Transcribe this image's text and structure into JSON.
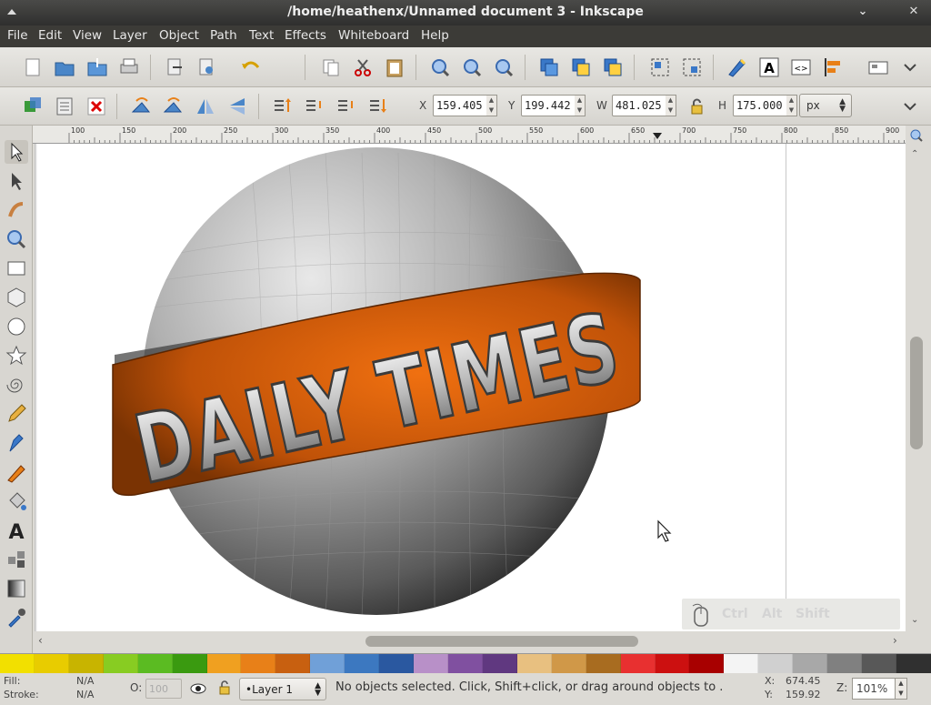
{
  "window": {
    "title": "/home/heathenx/Unnamed document 3 - Inkscape",
    "controls": [
      "chevron-down-icon",
      "close-icon"
    ]
  },
  "menu": [
    "File",
    "Edit",
    "View",
    "Layer",
    "Object",
    "Path",
    "Text",
    "Effects",
    "Whiteboard",
    "Help"
  ],
  "command_bar": {
    "icons": [
      "new-document-icon",
      "open-icon",
      "import-icon",
      "print-icon",
      "export-icon",
      "export-bitmap-icon",
      "undo-icon",
      "copy-icon",
      "cut-icon",
      "paste-icon",
      "zoom-selection-icon",
      "zoom-drawing-icon",
      "zoom-page-icon",
      "duplicate-icon",
      "clone-icon",
      "unlink-clone-icon",
      "group-icon",
      "ungroup-icon",
      "fill-stroke-icon",
      "text-font-icon",
      "xml-editor-icon",
      "align-icon",
      "preferences-icon",
      "more-icon"
    ]
  },
  "control_bar": {
    "icons": [
      "select-all-icon",
      "select-all-layers-icon",
      "deselect-icon",
      "rotate-ccw-icon",
      "rotate-cw-icon",
      "flip-horizontal-icon",
      "flip-vertical-icon",
      "raise-top-icon",
      "raise-icon",
      "lower-icon",
      "lower-bottom-icon"
    ],
    "x_label": "X",
    "x_value": "159.405",
    "y_label": "Y",
    "y_value": "199.442",
    "w_label": "W",
    "w_value": "481.025",
    "h_label": "H",
    "h_value": "175.000",
    "unit": "px"
  },
  "rulers": {
    "marks": [
      "100",
      "150",
      "200",
      "250",
      "300",
      "350",
      "400",
      "450",
      "500",
      "550",
      "600",
      "650",
      "700",
      "750",
      "800",
      "850",
      "900",
      "950"
    ]
  },
  "toolbox": [
    "selector-icon",
    "node-icon",
    "tweak-icon",
    "zoom-icon",
    "rectangle-icon",
    "box3d-icon",
    "ellipse-icon",
    "star-icon",
    "spiral-icon",
    "pencil-icon",
    "pen-icon",
    "calligraphy-icon",
    "paint-bucket-icon",
    "text-icon",
    "spray-icon",
    "gradient-icon",
    "dropper-icon"
  ],
  "artwork": {
    "banner_text": "DAILY TIMES",
    "sphere_colors": {
      "light": "#e8e8e8",
      "dark": "#2b2b2b"
    },
    "banner_colors": {
      "bright": "#f07010",
      "dark": "#7a3303"
    }
  },
  "keys_overlay": {
    "ctrl": "Ctrl",
    "alt": "Alt",
    "shift": "Shift"
  },
  "palette": [
    "#f2e000",
    "#e8cc00",
    "#c8b400",
    "#88cc22",
    "#5bbb22",
    "#3a9a10",
    "#f0a020",
    "#e88018",
    "#c86010",
    "#70a0d8",
    "#3c78c0",
    "#2a58a0",
    "#b890c8",
    "#8050a0",
    "#603880",
    "#e8c080",
    "#d09848",
    "#a86c20",
    "#e83030",
    "#cc1010",
    "#a80000",
    "#f4f4f4",
    "#d0d0d0",
    "#a8a8a8",
    "#808080",
    "#585858",
    "#303030"
  ],
  "status": {
    "fill_label": "Fill:",
    "fill_value": "N/A",
    "stroke_label": "Stroke:",
    "stroke_value": "N/A",
    "opacity_label": "O:",
    "opacity_value": "100",
    "layer": "•Layer 1",
    "message": "No objects selected. Click, Shift+click, or drag around objects to .",
    "x_label": "X:",
    "x_value": "674.45",
    "y_label": "Y:",
    "y_value": "159.92",
    "zoom_label": "Z:",
    "zoom_value": "101%"
  }
}
